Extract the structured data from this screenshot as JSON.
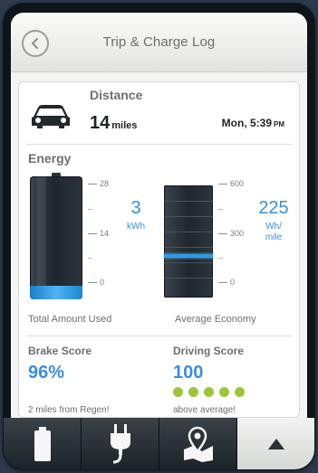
{
  "header": {
    "title": "Trip & Charge Log",
    "back_icon": "chevron-left-circle-icon"
  },
  "distance": {
    "label": "Distance",
    "value": "14",
    "unit": "miles",
    "time": "Mon, 5:39",
    "ampm": "PM",
    "icon": "car-icon"
  },
  "energy": {
    "label": "Energy",
    "battery": {
      "value": "3",
      "unit": "kWh",
      "scale": [
        "28",
        "14",
        "0"
      ],
      "level": 0.107,
      "caption": "Total Amount Used"
    },
    "economy": {
      "value": "225",
      "unit_line1": "Wh/",
      "unit_line2": "mile",
      "scale": [
        "600",
        "300",
        "0"
      ],
      "level": 0.375,
      "caption": "Average Economy"
    }
  },
  "brake": {
    "label": "Brake Score",
    "value": "96%",
    "note": "2 miles from Regen!"
  },
  "driving": {
    "label": "Driving Score",
    "value": "100",
    "dots": 5,
    "note": "above average!"
  },
  "tabs": [
    {
      "icon": "battery-icon"
    },
    {
      "icon": "plug-icon"
    },
    {
      "icon": "map-pin-icon"
    },
    {
      "icon": "up-arrow-icon"
    }
  ],
  "colors": {
    "accent": "#3b8ed7",
    "battery_fill": "#2f9ae8",
    "dots": "#9bc63c"
  }
}
